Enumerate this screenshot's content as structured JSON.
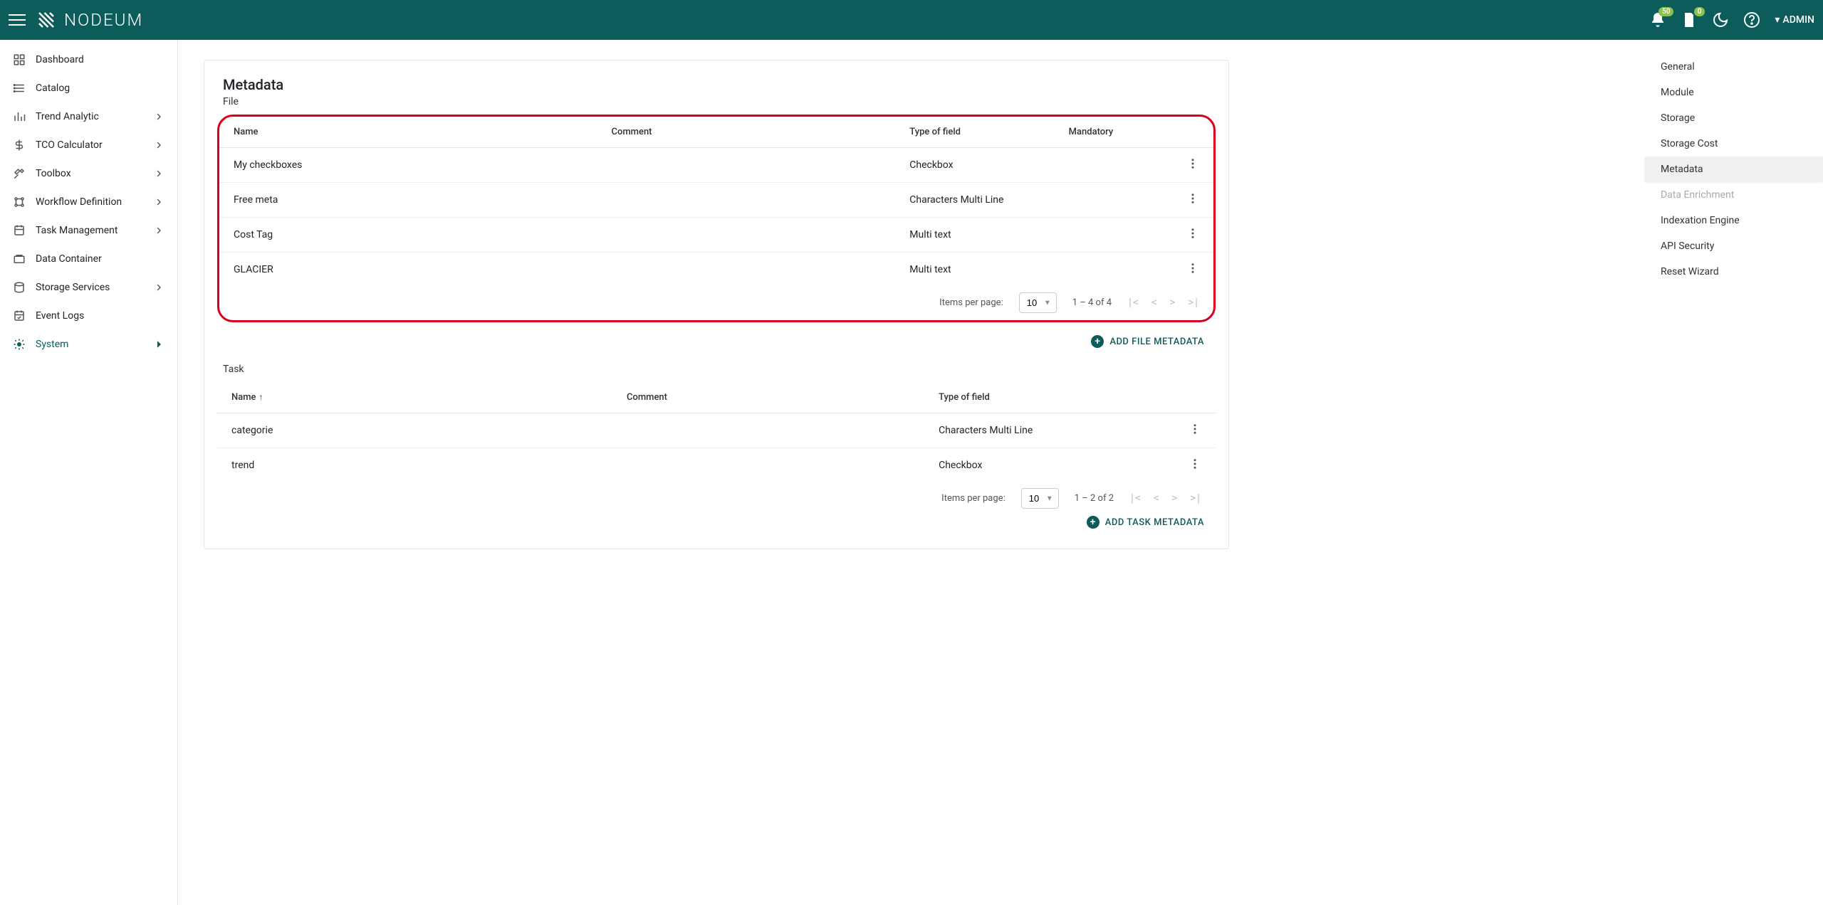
{
  "header": {
    "brand": "NODEUM",
    "notif_badge": "50",
    "tasks_badge": "0",
    "user_label": "ADMIN"
  },
  "sidebar": {
    "items": [
      {
        "label": "Dashboard",
        "icon": "dashboard",
        "expandable": false
      },
      {
        "label": "Catalog",
        "icon": "catalog",
        "expandable": false
      },
      {
        "label": "Trend Analytic",
        "icon": "analytics",
        "expandable": true
      },
      {
        "label": "TCO Calculator",
        "icon": "dollar",
        "expandable": true
      },
      {
        "label": "Toolbox",
        "icon": "tools",
        "expandable": true
      },
      {
        "label": "Workflow Definition",
        "icon": "workflow",
        "expandable": true
      },
      {
        "label": "Task Management",
        "icon": "task",
        "expandable": true
      },
      {
        "label": "Data Container",
        "icon": "container",
        "expandable": false
      },
      {
        "label": "Storage Services",
        "icon": "storage",
        "expandable": true
      },
      {
        "label": "Event Logs",
        "icon": "events",
        "expandable": false
      },
      {
        "label": "System",
        "icon": "gear",
        "expandable": true,
        "active": true
      }
    ]
  },
  "page": {
    "title": "Metadata",
    "file_label": "File",
    "task_label": "Task"
  },
  "file_table": {
    "headers": {
      "name": "Name",
      "comment": "Comment",
      "type": "Type of field",
      "mandatory": "Mandatory"
    },
    "rows": [
      {
        "name": "My checkboxes",
        "comment": "",
        "type": "Checkbox",
        "mandatory": ""
      },
      {
        "name": "Free meta",
        "comment": "",
        "type": "Characters Multi Line",
        "mandatory": ""
      },
      {
        "name": "Cost Tag",
        "comment": "",
        "type": "Multi text",
        "mandatory": ""
      },
      {
        "name": "GLACIER",
        "comment": "",
        "type": "Multi text",
        "mandatory": ""
      }
    ],
    "paginator": {
      "items_label": "Items per page:",
      "per_page": "10",
      "range": "1 – 4 of 4"
    },
    "add_label": "ADD FILE METADATA"
  },
  "task_table": {
    "headers": {
      "name": "Name",
      "comment": "Comment",
      "type": "Type of field"
    },
    "rows": [
      {
        "name": "categorie",
        "comment": "",
        "type": "Characters Multi Line"
      },
      {
        "name": "trend",
        "comment": "",
        "type": "Checkbox"
      }
    ],
    "paginator": {
      "items_label": "Items per page:",
      "per_page": "10",
      "range": "1 – 2 of 2"
    },
    "add_label": "ADD TASK METADATA"
  },
  "right_panel": {
    "items": [
      {
        "label": "General"
      },
      {
        "label": "Module"
      },
      {
        "label": "Storage"
      },
      {
        "label": "Storage Cost"
      },
      {
        "label": "Metadata",
        "active": true
      },
      {
        "label": "Data Enrichment",
        "disabled": true
      },
      {
        "label": "Indexation Engine"
      },
      {
        "label": "API Security"
      },
      {
        "label": "Reset Wizard"
      }
    ]
  }
}
